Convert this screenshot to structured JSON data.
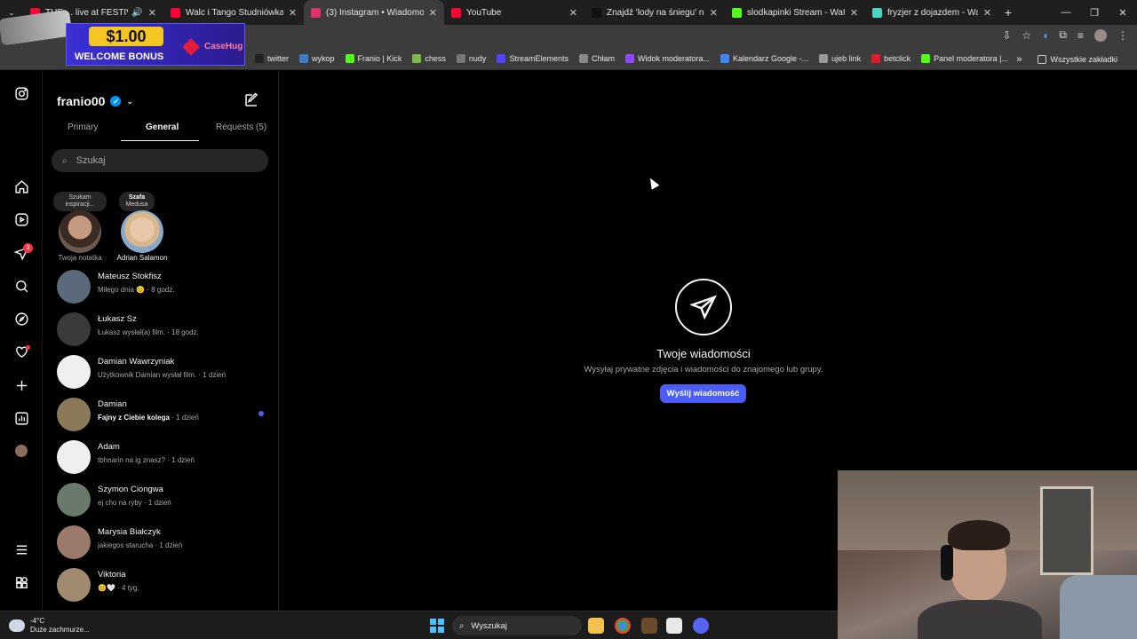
{
  "browser": {
    "tabs": [
      {
        "title": "THE ... live at FESTIVALAND",
        "color": "#ff0033",
        "active": false,
        "audio": true
      },
      {
        "title": "Walc i Tango Studniówka 2025",
        "color": "#ff0033",
        "active": false
      },
      {
        "title": "(3) Instagram • Wiadomości",
        "color": "#e1306c",
        "active": true
      },
      {
        "title": "YouTube",
        "color": "#ff0033",
        "active": false
      },
      {
        "title": "Znajdź 'lody na śniegu' na TikT",
        "color": "#111111",
        "active": false
      },
      {
        "title": "slodkapinki Stream - Watch Liv",
        "color": "#53fc18",
        "active": false
      },
      {
        "title": "fryzjer z dojazdem - Warszawa",
        "color": "#4bd6c1",
        "active": false
      }
    ],
    "bookmarks": [
      {
        "label": "twitter",
        "color": "#222222"
      },
      {
        "label": "wykop",
        "color": "#3b7cc4"
      },
      {
        "label": "Franio | Kick",
        "color": "#53fc18"
      },
      {
        "label": "chess",
        "color": "#81b64c"
      },
      {
        "label": "nudy",
        "color": "#777777"
      },
      {
        "label": "StreamElements",
        "color": "#5044ff"
      },
      {
        "label": "Chłam",
        "color": "#888888"
      },
      {
        "label": "Widok moderatora...",
        "color": "#9146ff"
      },
      {
        "label": "Kalendarz Google -...",
        "color": "#4285f4"
      },
      {
        "label": "ujeb link",
        "color": "#999999"
      },
      {
        "label": "betclick",
        "color": "#e21a2c"
      },
      {
        "label": "Panel moderatora |...",
        "color": "#53fc18"
      }
    ],
    "all_bookmarks": "Wszystkie zakładki"
  },
  "ad": {
    "amount": "$1.00",
    "text": "WELCOME BONUS",
    "brand": "CaseHug"
  },
  "instagram": {
    "username": "franio00",
    "tabs": [
      "Primary",
      "General",
      "Requests (5)"
    ],
    "search_placeholder": "Szukaj",
    "notes": [
      {
        "bubble_line1": "Szukam",
        "bubble_line2": "inspiracji...",
        "caption": "Twoja notatka"
      },
      {
        "bubble_line1": "Szafa",
        "bubble_line2": "Medusa",
        "caption": "Adrian Salamon"
      }
    ],
    "notification_count": "3",
    "chats": [
      {
        "name": "Mateusz Stokfisz",
        "preview": "Miłego dnia 😊 · 8 godz.",
        "unread": false,
        "avatar": "#5a6a7a"
      },
      {
        "name": "Łukasz Sz",
        "preview": "Łukasz wysłał(a) film. · 18 godz.",
        "unread": false,
        "avatar": "#3a3a3a"
      },
      {
        "name": "Damian Wawrzyniak",
        "preview": "Użytkownik Damian wysłał film. · 1 dzień",
        "unread": false,
        "avatar": "#efefef"
      },
      {
        "name": "Damian",
        "preview": "Fajny z Ciebie kolega",
        "time": " · 1 dzień",
        "unread": true,
        "avatar": "#8a7a5a"
      },
      {
        "name": "Adam",
        "preview": "tbhnarin na ig znasz? · 1 dzień",
        "unread": false,
        "avatar": "#efefef"
      },
      {
        "name": "Szymon Ciongwa",
        "preview": "ej cho na ryby · 1 dzień",
        "unread": false,
        "avatar": "#6a7a6a"
      },
      {
        "name": "Marysia Białczyk",
        "preview": "jakiegos starucha · 1 dzień",
        "unread": false,
        "avatar": "#9a7a6a"
      },
      {
        "name": "Viktoria",
        "preview": "😊🤍 · 4 tyg.",
        "unread": false,
        "avatar": "#a08a70"
      }
    ],
    "empty": {
      "title": "Twoje wiadomości",
      "subtitle": "Wysyłaj prywatne zdjęcia i wiadomości do znajomego lub grupy.",
      "button": "Wyślij wiadomość"
    }
  },
  "taskbar": {
    "temp": "-4°C",
    "weather": "Duże zachmurze...",
    "search": "Wyszukaj"
  }
}
